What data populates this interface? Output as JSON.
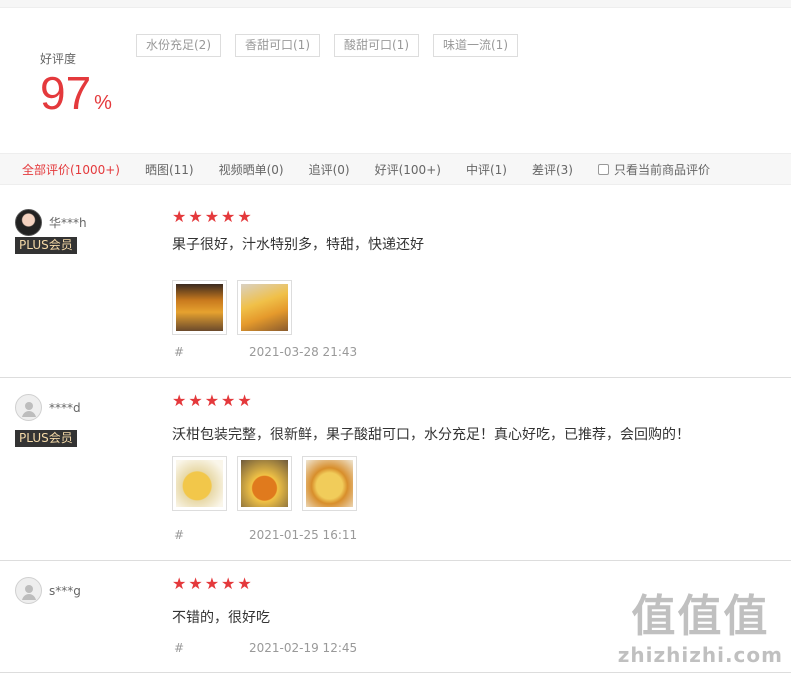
{
  "rating": {
    "label": "好评度",
    "value": "97",
    "unit": "%"
  },
  "tags": [
    "水份充足(2)",
    "香甜可口(1)",
    "酸甜可口(1)",
    "味道一流(1)"
  ],
  "filters": {
    "tabs": [
      "全部评价(1000+)",
      "晒图(11)",
      "视频晒单(0)",
      "追评(0)",
      "好评(100+)",
      "中评(1)",
      "差评(3)"
    ],
    "active_index": 0,
    "only_current_label": "只看当前商品评价",
    "only_current_checked": false
  },
  "reviews": [
    {
      "username": "华***h",
      "avatar": "anime-avatar",
      "badge": "PLUS会员",
      "stars": 5,
      "content": "果子很好，汁水特别多，特甜，快递还好",
      "photo_count": 2,
      "hash": "#",
      "date": "2021-03-28 21:43"
    },
    {
      "username": "****d",
      "avatar": "default-avatar",
      "badge": "PLUS会员",
      "stars": 5,
      "content": "沃柑包装完整，很新鲜，果子酸甜可口，水分充足！真心好吃，已推荐，会回购的！",
      "photo_count": 3,
      "hash": "#",
      "date": "2021-01-25 16:11"
    },
    {
      "username": "s***g",
      "avatar": "default-avatar",
      "badge": "",
      "stars": 5,
      "content": "不错的，很好吃",
      "photo_count": 0,
      "hash": "#",
      "date": "2021-02-19 12:45"
    }
  ],
  "watermark": {
    "glyphs": "值值值",
    "text": "zhizhizhi.com"
  },
  "colors": {
    "accent": "#e4393c",
    "plus_badge_bg": "#333333",
    "plus_badge_text": "#f4d9a7"
  }
}
